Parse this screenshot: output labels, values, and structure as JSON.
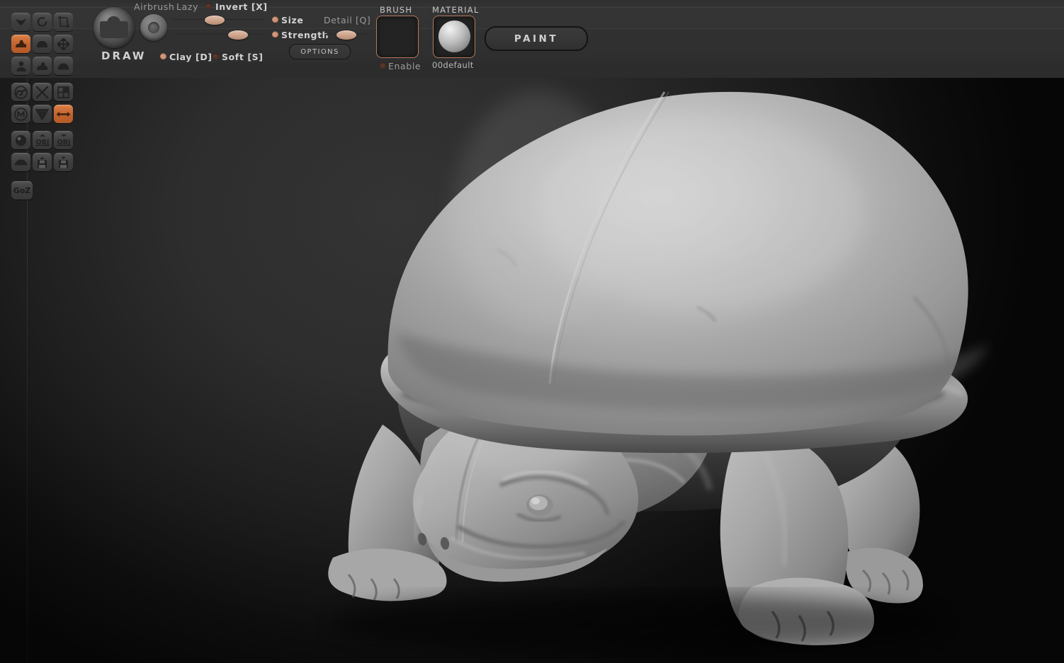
{
  "app": {
    "mode_label": "DRAW",
    "paint_button": "PAINT",
    "options_button": "OPTIONS"
  },
  "left_rail": {
    "rows": [
      [
        {
          "name": "edit-object-icon",
          "glyph": "edit"
        },
        {
          "name": "rotate-icon",
          "glyph": "rotate"
        },
        {
          "name": "transform-frame-icon",
          "glyph": "frame"
        }
      ],
      [
        {
          "name": "draw-mode-icon",
          "glyph": "draw",
          "active": true
        },
        {
          "name": "move-blob-icon",
          "glyph": "blob"
        },
        {
          "name": "move-arrows-icon",
          "glyph": "arrows"
        }
      ],
      [
        {
          "name": "scale-icon",
          "glyph": "scale"
        },
        {
          "name": "smooth-icon",
          "glyph": "smooth"
        },
        {
          "name": "flatten-icon",
          "glyph": "flatten"
        }
      ],
      [
        {
          "name": "symmetry-swirl-icon",
          "glyph": "swirl"
        },
        {
          "name": "no-symmetry-icon",
          "glyph": "cross"
        },
        {
          "name": "grid-icon",
          "glyph": "grid"
        }
      ],
      [
        {
          "name": "mirror-m-icon",
          "glyph": "circleM"
        },
        {
          "name": "wireframe-icon",
          "glyph": "wire"
        },
        {
          "name": "symmetry-x-icon",
          "glyph": "dblarrow",
          "active": true
        }
      ],
      [
        {
          "name": "sphere-primitive-icon",
          "glyph": "sphere"
        },
        {
          "name": "import-obj-icon",
          "glyph": "objUp",
          "label": "OBJ"
        },
        {
          "name": "export-obj-icon",
          "glyph": "objDown",
          "label": "OBJ"
        }
      ],
      [
        {
          "name": "plane-icon",
          "glyph": "plane"
        },
        {
          "name": "load-tool-icon",
          "glyph": "diskUp"
        },
        {
          "name": "save-tool-icon",
          "glyph": "diskDown"
        }
      ],
      [
        {
          "name": "goz-icon",
          "glyph": "text",
          "label": "GoZ"
        }
      ]
    ]
  },
  "toolbar": {
    "airbrush_label": "Airbrush",
    "lazy_label": "Lazy",
    "invert_label": "Invert [X]",
    "invert_on": false,
    "clay_label": "Clay [D]",
    "clay_on": true,
    "soft_label": "Soft [S]",
    "soft_on": false,
    "size_label": "Size",
    "size_on": true,
    "strength_label": "Strength",
    "strength_on": true,
    "detail_label": "Detail [Q]",
    "size_slider_value": 45,
    "strength_slider_value": 62,
    "detail_slider_value": 55
  },
  "brush_panel": {
    "title": "BRUSH",
    "enable_label": "Enable",
    "enable_on": false
  },
  "material_panel": {
    "title": "MATERIAL",
    "name": "00default"
  },
  "colors": {
    "accent": "#c0632f",
    "accent_border": "#b4795a",
    "panel_bg": "#323232",
    "canvas_bg": "#2b2b2b",
    "text": "#c9c9c9",
    "text_dim": "#9a9a9a",
    "slider_knob": "#d3aa93"
  },
  "model": {
    "subject": "turtle-sculpt",
    "shading": "matcap-grey"
  }
}
